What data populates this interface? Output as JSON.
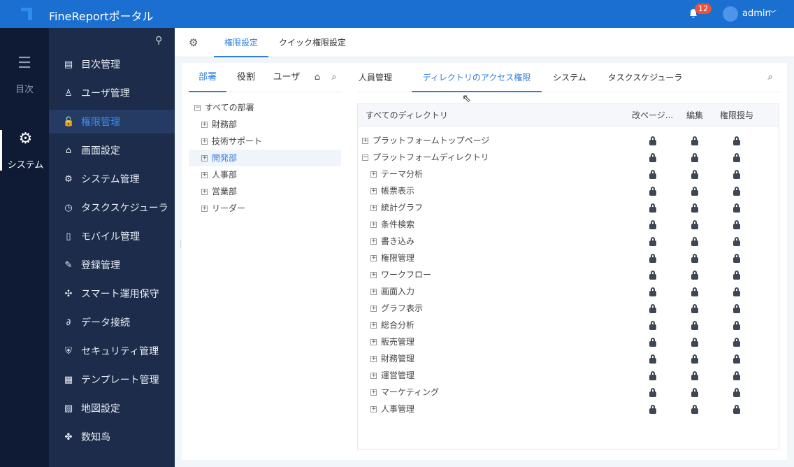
{
  "app": {
    "title": "FineReportポータル",
    "notifications": "12",
    "user": "admin"
  },
  "rail": [
    {
      "label": "目次",
      "icon": "list-icon"
    },
    {
      "label": "システム",
      "icon": "gear-icon"
    }
  ],
  "sidebar": [
    {
      "label": "目次管理",
      "icon": "▤"
    },
    {
      "label": "ユーザ管理",
      "icon": "♙"
    },
    {
      "label": "権限管理",
      "icon": "🔓"
    },
    {
      "label": "画面設定",
      "icon": "⌂"
    },
    {
      "label": "システム管理",
      "icon": "⚙"
    },
    {
      "label": "タスクスケジューラ",
      "icon": "◷"
    },
    {
      "label": "モバイル管理",
      "icon": "▯"
    },
    {
      "label": "登録管理",
      "icon": "✎"
    },
    {
      "label": "スマート運用保守",
      "icon": "✣"
    },
    {
      "label": "データ接続",
      "icon": "∂"
    },
    {
      "label": "セキュリティ管理",
      "icon": "⛨"
    },
    {
      "label": "テンプレート管理",
      "icon": "▦"
    },
    {
      "label": "地図設定",
      "icon": "▧"
    },
    {
      "label": "数知鸟",
      "icon": "✤"
    }
  ],
  "header_tabs": [
    "権限設定",
    "クイック権限設定"
  ],
  "left_tabs": [
    "部署",
    "役割",
    "ユーザ"
  ],
  "dept_tree": {
    "root": "すべての部署",
    "children": [
      "財務部",
      "技術サポート",
      "開発部",
      "人事部",
      "営業部",
      "リーダー"
    ]
  },
  "right_tabs": [
    "人員管理",
    "ディレクトリのアクセス権限",
    "システム",
    "タスクスケジューラ"
  ],
  "table": {
    "headers": [
      "すべてのディレクトリ",
      "改ページ...",
      "編集",
      "権限授与"
    ],
    "top": [
      "プラットフォームトップページ",
      "プラットフォームディレクトリ"
    ],
    "children": [
      "テーマ分析",
      "帳票表示",
      "統計グラフ",
      "条件検索",
      "書き込み",
      "権限管理",
      "ワークフロー",
      "画面入力",
      "グラフ表示",
      "総合分析",
      "販売管理",
      "財務管理",
      "運営管理",
      "マーケティング",
      "人事管理"
    ]
  }
}
